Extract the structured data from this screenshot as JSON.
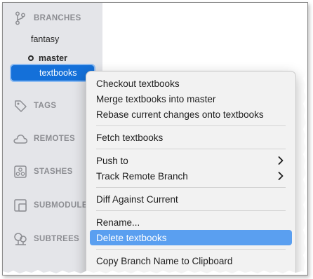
{
  "sidebar": {
    "branches_header": "BRANCHES",
    "branches": [
      {
        "name": "fantasy"
      },
      {
        "name": "master",
        "current": true
      },
      {
        "name": "textbooks",
        "selected": true
      }
    ],
    "tags_header": "TAGS",
    "remotes_header": "REMOTES",
    "stashes_header": "STASHES",
    "submodules_header": "SUBMODULE",
    "subtrees_header": "SUBTREES"
  },
  "context_menu": {
    "checkout": "Checkout textbooks",
    "merge": "Merge textbooks into master",
    "rebase": "Rebase current changes onto textbooks",
    "fetch": "Fetch textbooks",
    "push_to": "Push to",
    "track_remote": "Track Remote Branch",
    "diff": "Diff Against Current",
    "rename": "Rename...",
    "delete": "Delete textbooks",
    "copy_name": "Copy Branch Name to Clipboard"
  },
  "colors": {
    "selection": "#1470d9",
    "menu_highlight": "#5a9ff0",
    "sidebar_bg": "#e4e5e9"
  },
  "icons": [
    "branch-icon",
    "tag-icon",
    "cloud-icon",
    "stash-icon",
    "submodule-icon",
    "subtree-icon",
    "chevron-right-icon"
  ]
}
